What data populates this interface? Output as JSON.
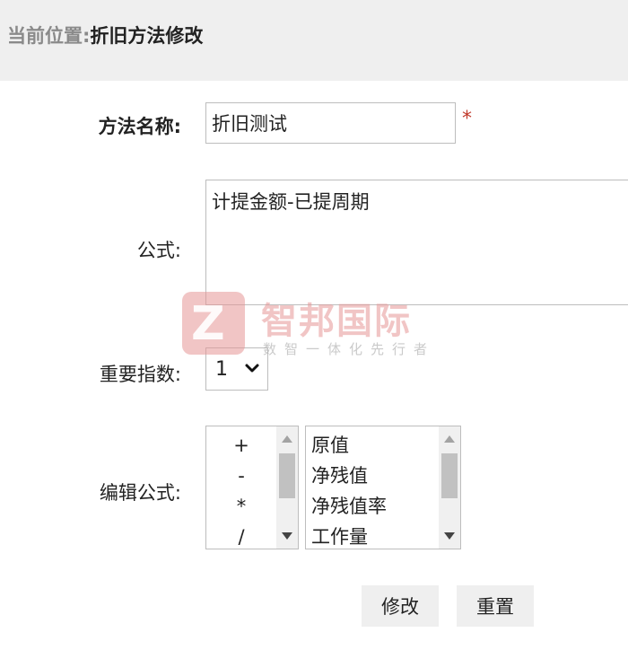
{
  "breadcrumb": {
    "prefix": "当前位置:",
    "title": "折旧方法修改"
  },
  "form": {
    "method_name": {
      "label": "方法名称:",
      "value": "折旧测试",
      "required_mark": "*"
    },
    "formula": {
      "label": "公式:",
      "value": "计提金额-已提周期"
    },
    "importance": {
      "label": "重要指数:",
      "selected": "1"
    },
    "edit_formula": {
      "label": "编辑公式:",
      "operators": [
        "+",
        "-",
        "*",
        "/"
      ],
      "fields": [
        "原值",
        "净残值",
        "净残值率",
        "工作量"
      ]
    }
  },
  "buttons": {
    "modify": "修改",
    "reset": "重置"
  },
  "watermark": {
    "logo_letter": "Z",
    "name": "智邦国际",
    "slogan": "数智一体化先行者"
  },
  "colors": {
    "header_bg": "#efefef",
    "required": "#c0392b",
    "watermark": "#e69696"
  },
  "icons": {
    "select_arrow": "chevron-down-icon",
    "scroll_up": "triangle-up-icon",
    "scroll_down": "triangle-down-icon"
  }
}
